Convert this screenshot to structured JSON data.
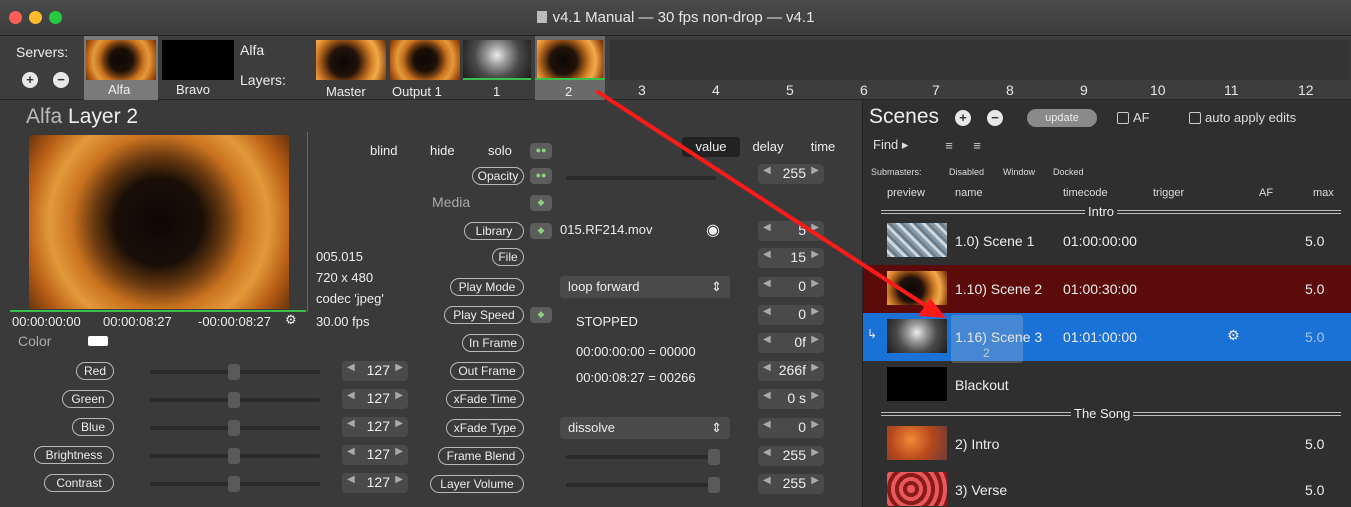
{
  "window": {
    "title": "v4.1 Manual  —  30 fps non-drop  —  v4.1",
    "traffic": [
      "#fc5f57",
      "#fdbc2e",
      "#28c840"
    ]
  },
  "servers": {
    "label": "Servers:",
    "items": [
      {
        "name": "Alfa",
        "selected": true
      },
      {
        "name": "Bravo",
        "selected": false
      }
    ],
    "add": "+",
    "remove": "−",
    "current": "Alfa"
  },
  "layers": {
    "label": "Layers:",
    "items": [
      "Master",
      "Output 1",
      "1",
      "2"
    ],
    "columns": [
      "3",
      "4",
      "5",
      "6",
      "7",
      "8",
      "9",
      "10",
      "11",
      "12"
    ],
    "selected": "2"
  },
  "layer_panel": {
    "title_server": "Alfa",
    "title_layer": "Layer 2",
    "info": [
      "005.015",
      "720 x 480",
      "codec 'jpeg'",
      "30.00 fps"
    ],
    "times": [
      "00:00:00:00",
      "00:00:08:27",
      "-00:00:08:27"
    ],
    "color_label": "Color",
    "buttons": [
      "blind",
      "hide",
      "solo"
    ],
    "tabs": [
      "value",
      "delay",
      "time"
    ],
    "media_label": "Media",
    "params": [
      {
        "label": "Opacity",
        "value": "255"
      },
      {
        "label": "Library",
        "field": "015.RF214.mov",
        "value": "5"
      },
      {
        "label": "File",
        "value": "15"
      },
      {
        "label": "Play Mode",
        "field": "loop forward",
        "value": "0"
      },
      {
        "label": "Play Speed",
        "field": "STOPPED",
        "value": "0"
      },
      {
        "label": "In Frame",
        "field": "00:00:00:00 = 00000",
        "value": "0f"
      },
      {
        "label": "Out Frame",
        "field": "00:00:08:27 = 00266",
        "value": "266f"
      },
      {
        "label": "xFade Time",
        "value": "0 s"
      },
      {
        "label": "xFade Type",
        "field": "dissolve",
        "value": "0"
      },
      {
        "label": "Frame Blend",
        "value": "255"
      },
      {
        "label": "Layer Volume",
        "value": "255"
      }
    ],
    "color_params": [
      {
        "label": "Red",
        "value": "127"
      },
      {
        "label": "Green",
        "value": "127"
      },
      {
        "label": "Blue",
        "value": "127"
      },
      {
        "label": "Brightness",
        "value": "127"
      },
      {
        "label": "Contrast",
        "value": "127"
      }
    ]
  },
  "scenes": {
    "title": "Scenes",
    "update_label": "update",
    "af_label": "AF",
    "auto_apply_label": "auto apply edits",
    "find_label": "Find",
    "submasters": [
      "Submasters:",
      "Disabled",
      "Window",
      "Docked"
    ],
    "headers": [
      "preview",
      "name",
      "timecode",
      "trigger",
      "AF",
      "max"
    ],
    "groups": [
      {
        "label": "Intro"
      },
      {
        "label": "The Song"
      }
    ],
    "rows": [
      {
        "name": "1.0) Scene 1",
        "timecode": "01:00:00:00",
        "max": "5.0",
        "state": "normal"
      },
      {
        "name": "1.10) Scene 2",
        "timecode": "01:00:30:00",
        "max": "5.0",
        "state": "playing"
      },
      {
        "name": "1.16) Scene 3",
        "timecode": "01:01:00:00",
        "max": "5.0",
        "state": "selected"
      },
      {
        "name": "Blackout",
        "timecode": "",
        "max": "",
        "state": "normal"
      },
      {
        "name": "2) Intro",
        "timecode": "",
        "max": "5.0",
        "state": "normal"
      },
      {
        "name": "3) Verse",
        "timecode": "",
        "max": "5.0",
        "state": "normal"
      }
    ],
    "drag_label": "2"
  }
}
